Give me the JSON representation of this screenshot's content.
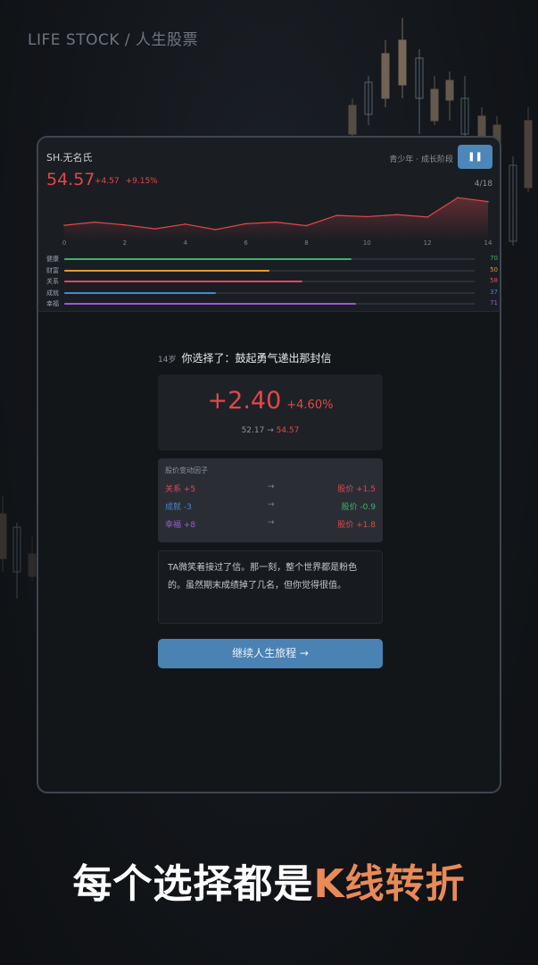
{
  "brand": {
    "title": "LIFE STOCK / 人生股票"
  },
  "header": {
    "ticker": "SH.无名氏",
    "price": "54.57",
    "change_abs": "+4.57",
    "change_pct": "+9.15%",
    "stage": "青少年 · 成长阶段",
    "progress": "4/18",
    "pause_icon": "pause-icon"
  },
  "chart_data": {
    "type": "area",
    "x": [
      0,
      1,
      2,
      3,
      4,
      5,
      6,
      7,
      8,
      9,
      10,
      11,
      12,
      13,
      14
    ],
    "values": [
      51.5,
      52.3,
      51.6,
      50.6,
      51.8,
      50.4,
      51.9,
      52.3,
      51.4,
      54.0,
      53.7,
      54.2,
      53.6,
      58.5,
      57.5
    ],
    "xticks": [
      "0",
      "2",
      "4",
      "6",
      "8",
      "10",
      "12",
      "14"
    ],
    "color": "#e2474b",
    "grid": false
  },
  "stats": [
    {
      "label": "健康",
      "value": 70,
      "color": "#3bb46a"
    },
    {
      "label": "财富",
      "value": 50,
      "color": "#e39b2f"
    },
    {
      "label": "关系",
      "value": 58,
      "color": "#e2475f"
    },
    {
      "label": "成就",
      "value": 37,
      "color": "#4a86c8"
    },
    {
      "label": "幸福",
      "value": 71,
      "color": "#9b5bd6"
    }
  ],
  "choice": {
    "age": "14岁",
    "text": "你选择了：鼓起勇气递出那封信"
  },
  "delta": {
    "change": "+2.40",
    "pct": "+4.60%",
    "from": "52.17",
    "arrow": "→",
    "to": "54.57"
  },
  "factors": {
    "title": "股价变动因子",
    "rows": [
      {
        "name": "关系 +5",
        "name_color": "#e2475f",
        "arrow": "→",
        "result": "股价 +1.5",
        "result_color": "#e2474b"
      },
      {
        "name": "成就 -3",
        "name_color": "#4a86c8",
        "arrow": "→",
        "result": "股价 -0.9",
        "result_color": "#3bb46a"
      },
      {
        "name": "幸福 +8",
        "name_color": "#9b5bd6",
        "arrow": "→",
        "result": "股价 +1.8",
        "result_color": "#e2474b"
      }
    ]
  },
  "story": "TA微笑着接过了信。那一刻，整个世界都是粉色的。虽然期末成绩掉了几名，但你觉得很值。",
  "continue_label": "继续人生旅程 →",
  "slogan": {
    "main": "每个选择都是",
    "accent": "K线转折"
  },
  "colors": {
    "up": "#e2474b",
    "down": "#3bb46a",
    "accent": "#4a82b4",
    "slogan_accent": "#e98a57"
  }
}
